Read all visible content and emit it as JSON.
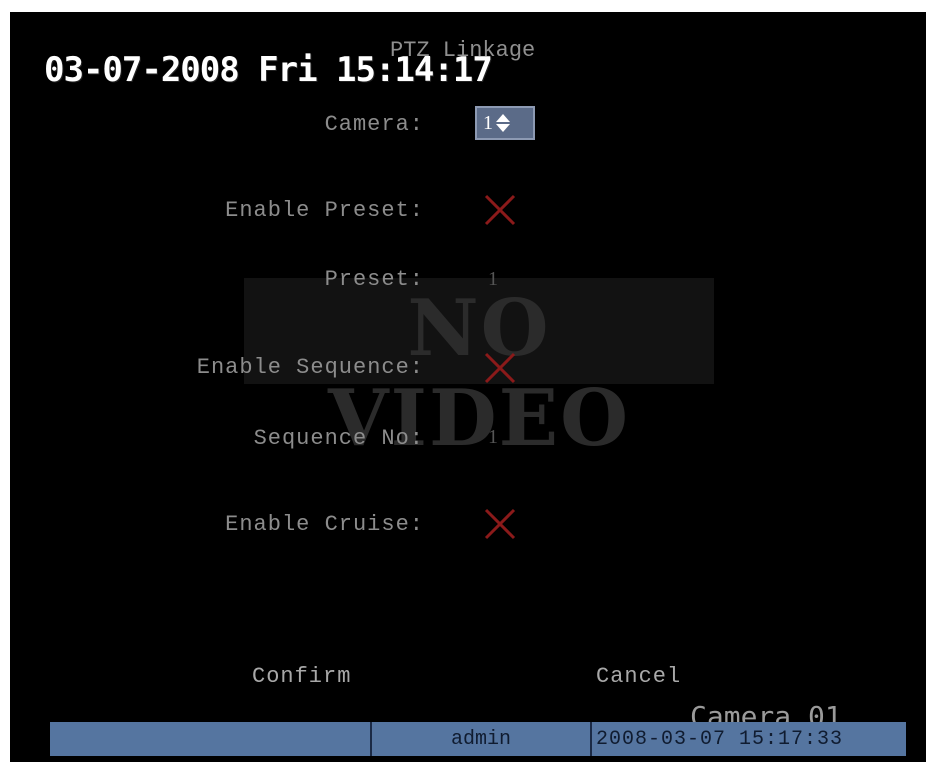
{
  "osd": {
    "datetime": "03-07-2008 Fri 15:14:17",
    "camera_label": "Camera 01"
  },
  "menu": {
    "title": "PTZ Linkage",
    "camera_label": "Camera:",
    "camera_value": "1",
    "enable_preset_label": "Enable Preset:",
    "enable_preset_state": "off",
    "preset_label": "Preset:",
    "preset_value": "1",
    "enable_sequence_label": "Enable Sequence:",
    "enable_sequence_state": "off",
    "sequence_no_label": "Sequence No:",
    "sequence_no_value": "1",
    "enable_cruise_label": "Enable Cruise:",
    "enable_cruise_state": "off",
    "confirm_label": "Confirm",
    "cancel_label": "Cancel"
  },
  "overlay": {
    "no_video_text": "NO VIDEO"
  },
  "statusbar": {
    "user": "admin",
    "datetime": "2008-03-07 15:17:33"
  },
  "colors": {
    "background": "#000000",
    "cross_red": "#8b1a1a",
    "status_bar": "#5575a0",
    "spinner_bg": "#5b6b88"
  },
  "icons": {
    "spinner_arrows": "up-down-arrows-icon",
    "disabled_mark": "red-x-icon"
  }
}
